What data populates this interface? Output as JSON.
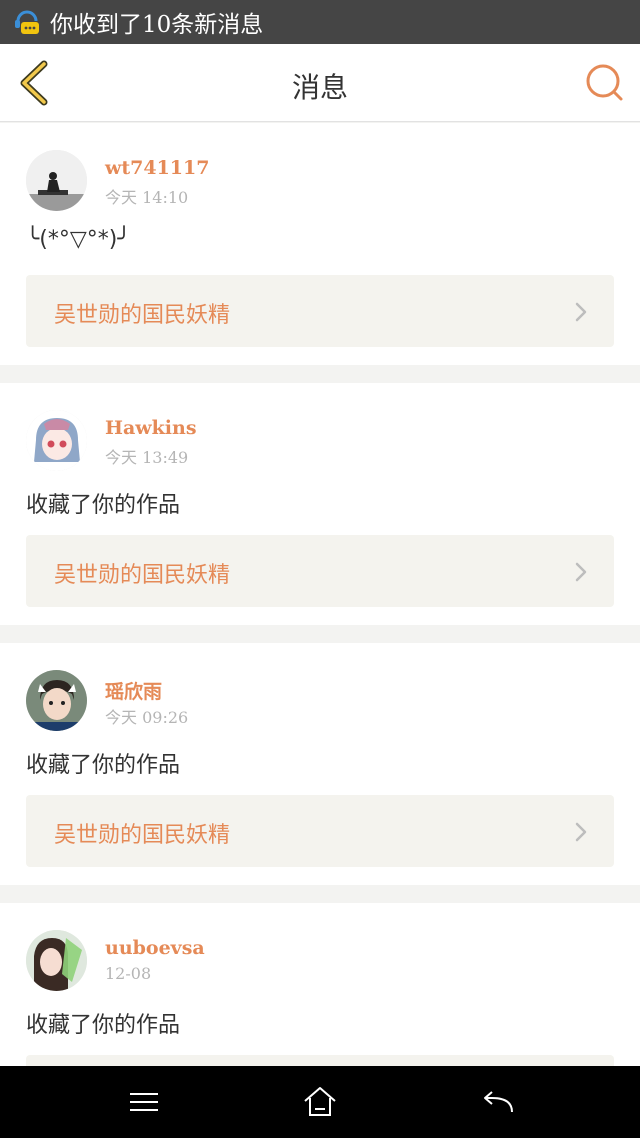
{
  "status_bar": {
    "notification_text": "你收到了10条新消息",
    "icon": "chat-notification-icon"
  },
  "header": {
    "title": "消息",
    "back_icon": "chevron-left-icon",
    "search_icon": "search-icon",
    "accent_color": "#e58a57"
  },
  "messages": [
    {
      "username": "wt741117",
      "time": "今天 14:10",
      "content": "╰(*°▽°*)╯",
      "work_title": "吴世勋的国民妖精",
      "avatar": "photo-avatar-silhouette"
    },
    {
      "username": "Hawkins",
      "time": "今天 13:49",
      "content": "收藏了你的作品",
      "work_title": "吴世勋的国民妖精",
      "avatar": "anime-girl-avatar"
    },
    {
      "username": "瑶欣雨",
      "time": "今天 09:26",
      "content": "收藏了你的作品",
      "work_title": "吴世勋的国民妖精",
      "avatar": "person-avatar"
    },
    {
      "username": "uuboevsa",
      "time": "12-08",
      "content": "收藏了你的作品",
      "work_title": "",
      "avatar": "girl-photo-avatar"
    }
  ],
  "nav_bar": {
    "menu_icon": "menu-icon",
    "home_icon": "home-icon",
    "back_icon": "back-arrow-icon"
  }
}
